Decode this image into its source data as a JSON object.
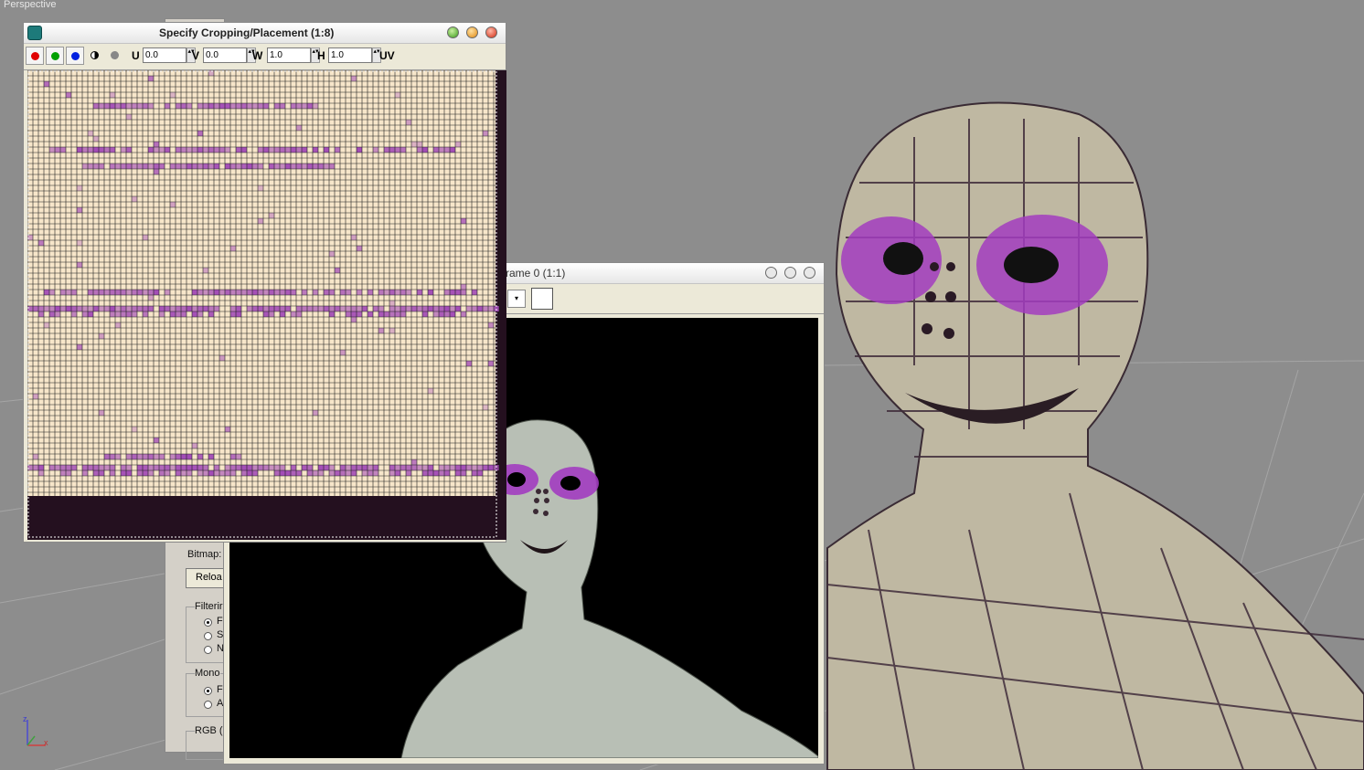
{
  "viewport": {
    "label": "Perspective"
  },
  "axis": {
    "z": "z",
    "x": "x"
  },
  "crop_window": {
    "title": "Specify Cropping/Placement (1:8)",
    "u_label": "U",
    "u_value": "0.0",
    "v_label": "V",
    "v_value": "0.0",
    "w_label": "W",
    "w_value": "1.0",
    "h_label": "H",
    "h_value": "1.0",
    "uv_label": "UV"
  },
  "frame_window": {
    "title": "rame 0 (1:1)"
  },
  "side_panel": {
    "bitmap_label": "Bitmap:",
    "reload_label": "Reloa",
    "filtering_label": "Filterir",
    "filter_opts": [
      "F",
      "S",
      "N"
    ],
    "mono_label": "Mono",
    "mono_opts": [
      "F",
      "A"
    ],
    "rgb_label": "RGB ("
  },
  "colors": {
    "texture_cream": "#f7e6ca",
    "texture_purple": "#a24bb6",
    "texture_dark": "#24101f",
    "grid_line": "#1e1e1e"
  }
}
